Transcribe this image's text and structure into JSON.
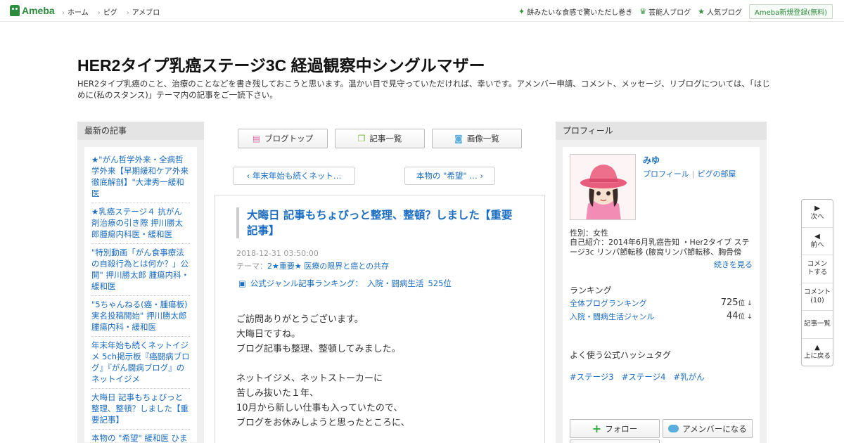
{
  "topbar": {
    "logo": "Ameba",
    "nav": [
      "ホーム",
      "ピグ",
      "アメブロ"
    ],
    "right": [
      {
        "icon": "sparkle-icon",
        "label": "餅みたいな食感で驚いただし巻き"
      },
      {
        "icon": "crown-icon",
        "label": "芸能人ブログ"
      },
      {
        "icon": "star-icon",
        "label": "人気ブログ"
      }
    ],
    "signup": "Ameba新規登録(無料)"
  },
  "header": {
    "title": "HER2タイプ乳癌ステージ3C 経過観察中シングルマザー",
    "description": "HER2タイプ乳癌のこと、治療のことなどを書き残しておこうと思います。温かい目で見守っていただければ、幸いです。アメンバー申請、コメント、メッセージ、リブログについては、「はじめに(私のスタンス)」テーマ内の記事をご一読下さい。"
  },
  "left": {
    "heading": "最新の記事",
    "items": [
      "★\"がん哲学外来・全病哲学外来【早期緩和ケア外来徹底解剖】\"大津秀一緩和医",
      "★乳癌ステージ４ 抗がん剤治療の引き際 押川勝太郎腫瘍内科医・緩和医",
      "\"特別動画「がん食事療法の自殺行為とは何か？」公開\" 押川勝太郎 腫瘍内科・緩和医",
      "\"5ちゃんねる(癌・腫瘍板)実名投稿開始\" 押川勝太郎腫瘍内科・緩和医",
      "年末年始も続くネットイジメ 5ch掲示板『癌闘病ブログ』『がん闘病ブログ』のネットイジメ",
      "大晦日 記事もちょびっと整理、整頓？しました【重要記事】",
      "本物の \"希望\" 緩和医 ひまわり先生 【再掲】"
    ]
  },
  "center": {
    "buttons": [
      {
        "icon": "document-icon",
        "label": "ブログトップ"
      },
      {
        "icon": "copy-icon",
        "label": "記事一覧"
      },
      {
        "icon": "camera-icon",
        "label": "画像一覧"
      }
    ],
    "prev": "‹ 年末年始も続くネット…",
    "next": "本物の \"希望\" … ›",
    "article": {
      "title": "大晦日 記事もちょびっと整理、整頓？しました【重要記事】",
      "date": "2018-12-31 03:50:00",
      "theme_prefix": "テーマ：",
      "theme": "2★重要★ 医療の限界と癌との共存",
      "ranking_prefix": "公式ジャンル記事ランキング：",
      "ranking_genre": "入院・闘病生活",
      "ranking_value": "525位",
      "body": [
        "ご訪問ありがとうございます。",
        "大晦日ですね。",
        "ブログ記事も整理、整頓してみました。",
        "",
        "ネットイジメ、ネットストーカーに",
        "苦しみ抜いた１年、",
        "10月から新しい仕事も入っていたので、",
        "ブログをお休みしようと思ったところに、"
      ]
    }
  },
  "right": {
    "heading": "プロフィール",
    "name": "みゆ",
    "link_profile": "プロフィール",
    "link_pig": "ピグの部屋",
    "gender": "性別：女性",
    "intro": "自己紹介：2014年6月乳癌告知 ・Her2タイプ ステージ3c リンパ節転移 (腋窩リンパ節転移、胸骨傍リ...",
    "more": "続きを見る",
    "ranking_heading": "ランキング",
    "rankings": [
      {
        "label": "全体ブログランキング",
        "value": "725",
        "unit": "位 ↓"
      },
      {
        "label": "入院・闘病生活ジャンル",
        "value": "44",
        "unit": "位 ↓"
      }
    ],
    "hashtag_heading": "よく使う公式ハッシュタグ",
    "hashtags": [
      "#ステージ3",
      "#ステージ4",
      "#乳がん"
    ],
    "follow": "フォロー",
    "member": "アメンバーになる"
  },
  "floatnav": [
    {
      "icon": "triangle-right-icon",
      "label": "次へ"
    },
    {
      "icon": "triangle-left-icon",
      "label": "前へ"
    },
    {
      "icon": "",
      "label": "コメントする"
    },
    {
      "icon": "",
      "label": "コメント(10)"
    },
    {
      "icon": "",
      "label": "記事一覧"
    },
    {
      "icon": "triangle-up-icon",
      "label": "上に戻る"
    }
  ]
}
